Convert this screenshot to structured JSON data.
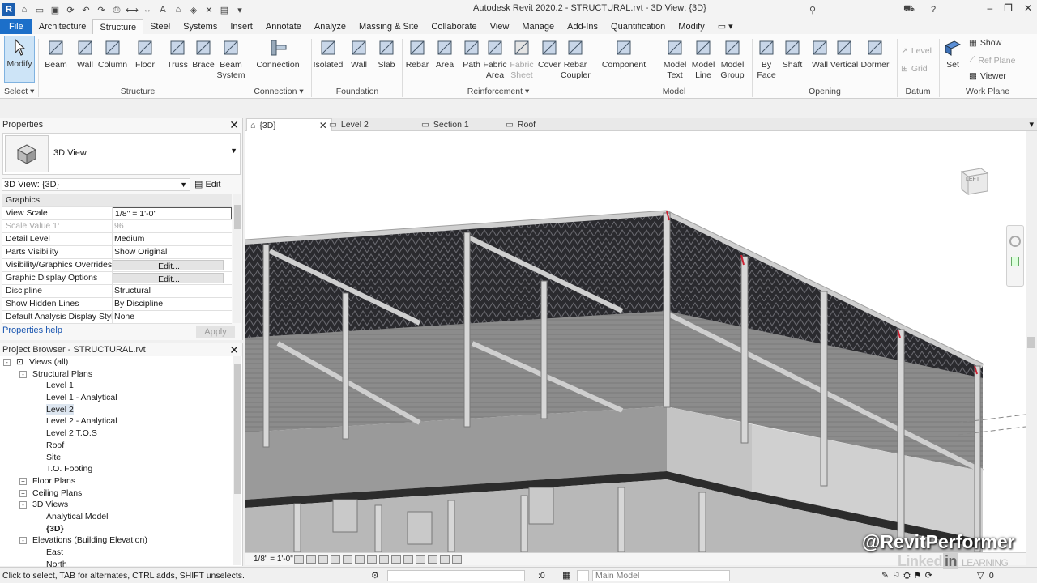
{
  "app": {
    "title": "Autodesk Revit 2020.2 - STRUCTURAL.rvt - 3D View: {3D}",
    "brand_color": "#1c6fc9"
  },
  "ribbon_tabs": [
    "File",
    "Architecture",
    "Structure",
    "Steel",
    "Systems",
    "Insert",
    "Annotate",
    "Analyze",
    "Massing & Site",
    "Collaborate",
    "View",
    "Manage",
    "Add-Ins",
    "Quantification",
    "Modify"
  ],
  "ribbon": {
    "modify": "Modify",
    "select": "Select",
    "structure_buttons": [
      "Beam",
      "Wall",
      "Column",
      "Floor",
      "Truss",
      "Brace",
      "Beam\nSystem"
    ],
    "structure_group": "Structure",
    "connection": "Connection",
    "connection_group": "Connection",
    "foundation_buttons": [
      "Isolated",
      "Wall",
      "Slab"
    ],
    "foundation_group": "Foundation",
    "reinforcement_buttons": [
      "Rebar",
      "Area",
      "Path",
      "Fabric\nArea",
      "Fabric\nSheet",
      "Cover",
      "Rebar\nCoupler"
    ],
    "reinforcement_group": "Reinforcement",
    "model_buttons": [
      "Component",
      "Model\nText",
      "Model\nLine",
      "Model\nGroup"
    ],
    "model_group": "Model",
    "opening_buttons": [
      "By\nFace",
      "Shaft",
      "Wall",
      "Vertical",
      "Dormer"
    ],
    "opening_group": "Opening",
    "datum_level": "Level",
    "datum_grid": "Grid",
    "datum_group": "Datum",
    "set": "Set",
    "show": "Show",
    "ref_plane": "Ref  Plane",
    "viewer": "Viewer",
    "workplane_group": "Work Plane"
  },
  "properties": {
    "title": "Properties",
    "type_name": "3D View",
    "instance": "3D View: {3D}",
    "edit_type": "Edit Type",
    "section": "Graphics",
    "rows": [
      {
        "name": "View Scale",
        "value": "1/8\" = 1'-0\""
      },
      {
        "name": "Scale Value    1:",
        "value": "96"
      },
      {
        "name": "Detail Level",
        "value": "Medium"
      },
      {
        "name": "Parts Visibility",
        "value": "Show Original"
      },
      {
        "name": "Visibility/Graphics Overrides",
        "value": "Edit..."
      },
      {
        "name": "Graphic Display Options",
        "value": "Edit..."
      },
      {
        "name": "Discipline",
        "value": "Structural"
      },
      {
        "name": "Show Hidden Lines",
        "value": "By Discipline"
      },
      {
        "name": "Default Analysis Display Style",
        "value": "None"
      }
    ],
    "help_link": "Properties help",
    "apply": "Apply"
  },
  "browser": {
    "title": "Project Browser - STRUCTURAL.rvt",
    "items": [
      {
        "label": "Views (all)",
        "depth": 0,
        "exp": "-",
        "icon": "[O]"
      },
      {
        "label": "Structural Plans",
        "depth": 1,
        "exp": "-"
      },
      {
        "label": "Level 1",
        "depth": 2
      },
      {
        "label": "Level 1 - Analytical",
        "depth": 2
      },
      {
        "label": "Level 2",
        "depth": 2,
        "selected": true
      },
      {
        "label": "Level 2 - Analytical",
        "depth": 2
      },
      {
        "label": "Level 2 T.O.S",
        "depth": 2
      },
      {
        "label": "Roof",
        "depth": 2
      },
      {
        "label": "Site",
        "depth": 2
      },
      {
        "label": "T.O. Footing",
        "depth": 2
      },
      {
        "label": "Floor Plans",
        "depth": 1,
        "exp": "+"
      },
      {
        "label": "Ceiling Plans",
        "depth": 1,
        "exp": "+"
      },
      {
        "label": "3D Views",
        "depth": 1,
        "exp": "-"
      },
      {
        "label": "Analytical Model",
        "depth": 2
      },
      {
        "label": "{3D}",
        "depth": 2,
        "bold": true
      },
      {
        "label": "Elevations (Building Elevation)",
        "depth": 1,
        "exp": "-"
      },
      {
        "label": "East",
        "depth": 2
      },
      {
        "label": "North",
        "depth": 2
      }
    ]
  },
  "view_tabs": [
    {
      "label": "{3D}",
      "active": true
    },
    {
      "label": "Level 2"
    },
    {
      "label": "Section 1"
    },
    {
      "label": "Roof"
    }
  ],
  "viewcube": "LEFT",
  "view_bar": {
    "scale": "1/8\" = 1'-0\""
  },
  "status": {
    "message": "Click to select, TAB for alternates, CTRL adds, SHIFT unselects.",
    "workset": ":0",
    "model": "Main Model",
    "filter": ":0"
  },
  "watermark": {
    "handle": "@RevitPerformer",
    "brand": "Linked",
    "brand_box": "in",
    "brand_suffix": "LEARNING"
  }
}
